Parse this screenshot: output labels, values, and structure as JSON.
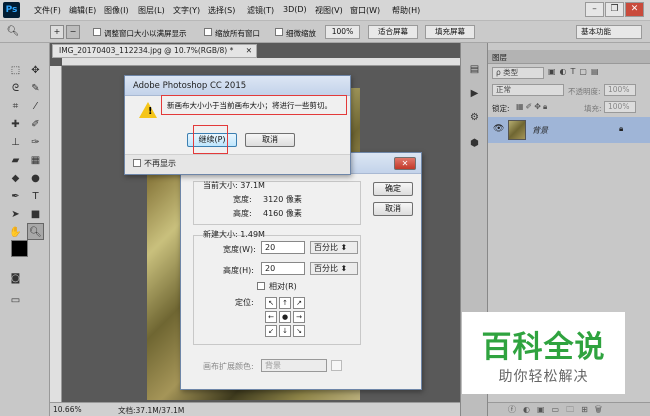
{
  "app": {
    "logo": "Ps"
  },
  "menubar": {
    "items": [
      "文件(F)",
      "编辑(E)",
      "图像(I)",
      "图层(L)",
      "文字(Y)",
      "选择(S)",
      "滤镜(T)",
      "3D(D)",
      "视图(V)",
      "窗口(W)",
      "帮助(H)"
    ],
    "minimize": "–",
    "restore": "❐",
    "close": "✕"
  },
  "options": {
    "resize_windows": "调整窗口大小以满屏显示",
    "zoom_all": "缩放所有窗口",
    "scrubby_zoom": "细微缩放",
    "btn_100": "100%",
    "btn_fit": "适合屏幕",
    "btn_fill": "填充屏幕",
    "workspace": "基本功能"
  },
  "document": {
    "tab_title": "IMG_20170403_112234.jpg @ 10.7%(RGB/8) *",
    "tab_close": "✕",
    "zoom": "10.66%",
    "doc_info": "文档:37.1M/37.1M"
  },
  "layers": {
    "tab_label": "图层",
    "kind_filter": "ρ 类型",
    "blend_mode": "正常",
    "opacity_label": "不透明度:",
    "opacity": "100%",
    "lock_label": "锁定:",
    "fill_label": "填充:",
    "fill": "100%",
    "layer_name": "背景"
  },
  "alert": {
    "title": "Adobe Photoshop CC 2015",
    "message": "新画布大小小于当前画布大小；将进行一些剪切。",
    "continue_button": "继续(P)",
    "cancel_button": "取消",
    "dont_show": "不再显示"
  },
  "canvas_dialog": {
    "current_size": "当前大小: 37.1M",
    "width_label": "宽度:",
    "width_value": "3120 像素",
    "height_label": "高度:",
    "height_value": "4160 像素",
    "ok_button": "确定",
    "cancel_button": "取消",
    "new_size": "新建大小: 1.49M",
    "new_width_label": "宽度(W):",
    "new_width_value": "20",
    "new_height_label": "高度(H):",
    "new_height_value": "20",
    "unit": "百分比",
    "relative": "相对(R)",
    "anchor_label": "定位:",
    "ext_color_label": "画布扩展颜色:",
    "ext_color_value": "背景",
    "close": "✕"
  },
  "watermark": {
    "title": "百科全说",
    "subtitle": "助你轻松解决"
  }
}
